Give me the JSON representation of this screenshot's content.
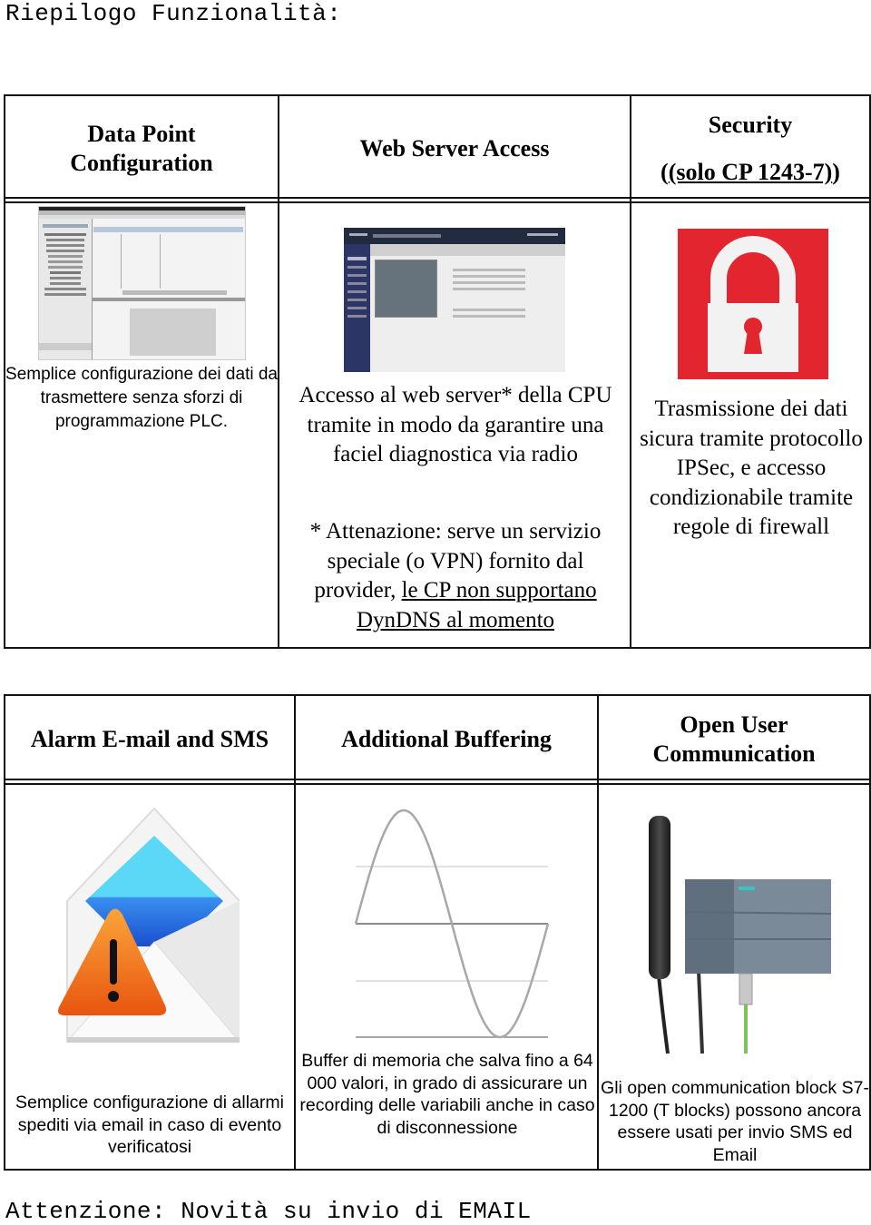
{
  "page": {
    "title": "Riepilogo Funzionalità:",
    "footer_note": "Attenzione: Novità su invio di EMAIL"
  },
  "table1": {
    "headers": [
      {
        "label": "Data Point Configuration"
      },
      {
        "label": "Web Server Access"
      },
      {
        "label_line1": "Security",
        "label_line2": "(solo CP 1243-7)"
      }
    ],
    "cells": [
      {
        "image": "tia-portal-data-point-configuration-screenshot",
        "description": "Semplice configurazione dei dati da trasmettere senza sforzi di programmazione PLC."
      },
      {
        "image": "s7-1200-web-server-screenshot",
        "webserver_title": "S7-1200 station_1/PLC_1",
        "description": "Accesso al web server* della CPU tramite in modo da garantire  una faciel diagnostica via radio",
        "note_plain": "* Attenazione: serve un servizio speciale (o VPN) fornito dal provider, ",
        "note_underlined": "le CP non supportano DynDNS al momento"
      },
      {
        "image": "padlock-icon",
        "icon_colors": {
          "background": "#e3252f",
          "lock": "#f2f2f2"
        },
        "description": "Trasmissione dei dati sicura tramite protocollo IPSec, e accesso condizionabile tramite regole di firewall"
      }
    ]
  },
  "table2": {
    "headers": [
      {
        "label": "Alarm E-mail and SMS"
      },
      {
        "label": "Additional Buffering"
      },
      {
        "label": "Open User Communication"
      }
    ],
    "cells": [
      {
        "image": "email-alarm-icon",
        "icon_colors": {
          "flap_top": "#5ad8f5",
          "flap_bottom": "#1e6fe0",
          "warning": "#f5821f"
        },
        "description": "Semplice configurazione di allarmi spediti via email in caso di evento verificatosi"
      },
      {
        "image": "sine-wave-buffer-graphic",
        "description": "Buffer di memoria che salva fino a 64 000 valori, in grado di assicurare un recording delle variabili anche in caso di disconnessione"
      },
      {
        "image": "antenna-and-plc-photo",
        "description": "Gli open communication block S7-1200 (T blocks) possono ancora essere usati per invio SMS ed Email"
      }
    ]
  }
}
